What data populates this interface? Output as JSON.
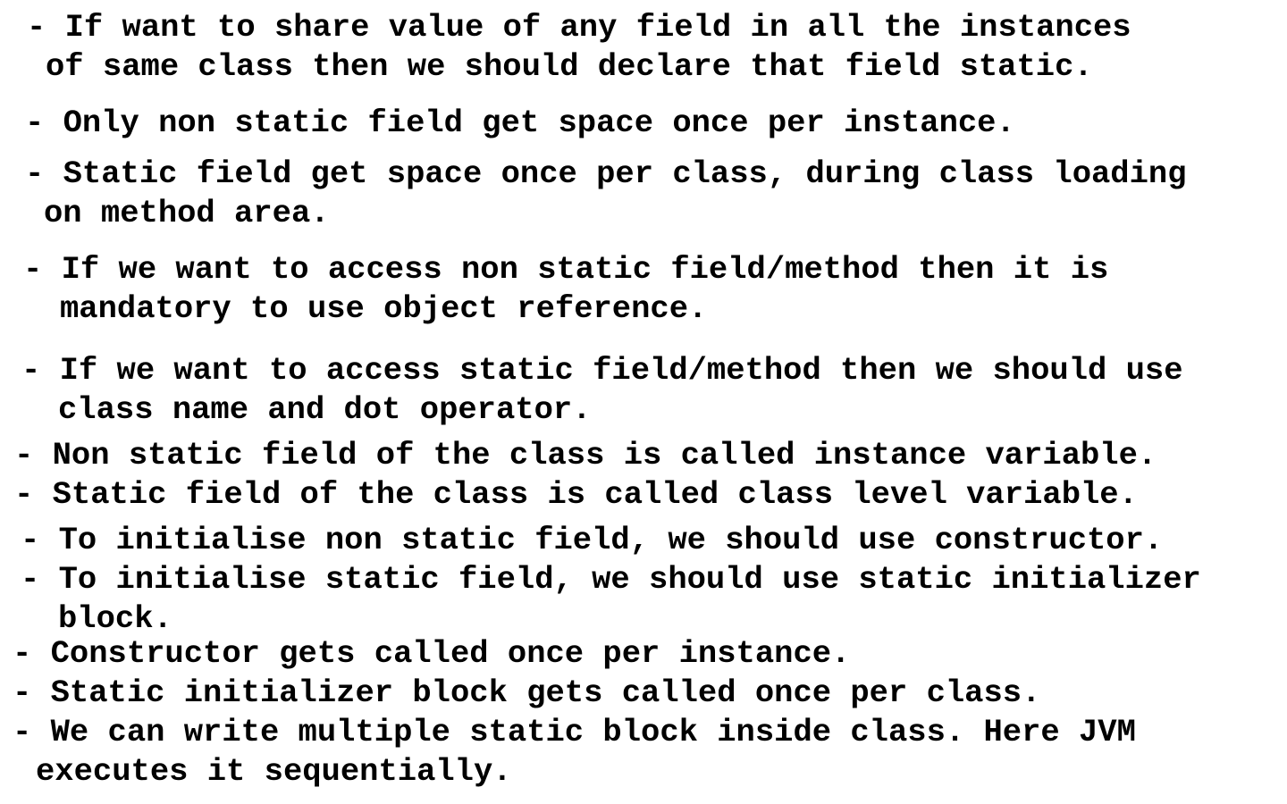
{
  "notes": [
    {
      "lines": [
        "- If want to share value of any field in all the instances",
        "of same class then we should declare that field static."
      ]
    },
    {
      "lines": [
        "- Only non static field get space once per instance."
      ]
    },
    {
      "lines": [
        "- Static field get space once per class, during class loading",
        "on method area."
      ]
    },
    {
      "lines": [
        "- If we want to access non static field/method then it is",
        "mandatory to use object reference."
      ]
    },
    {
      "lines": [
        "- If we want to access static field/method then we should use",
        "class name and dot operator."
      ]
    },
    {
      "lines": [
        "- Non static field of the class is called instance variable."
      ]
    },
    {
      "lines": [
        "- Static field of the class is called class level variable."
      ]
    },
    {
      "lines": [
        "- To initialise non static field, we should use constructor."
      ]
    },
    {
      "lines": [
        "- To initialise static field, we should use static initializer",
        "block."
      ]
    },
    {
      "lines": [
        "- Constructor gets called once per instance."
      ]
    },
    {
      "lines": [
        "- Static initializer block gets called once per class."
      ]
    },
    {
      "lines": [
        "- We can write multiple static block inside class. Here JVM",
        "executes it sequentially."
      ]
    }
  ]
}
